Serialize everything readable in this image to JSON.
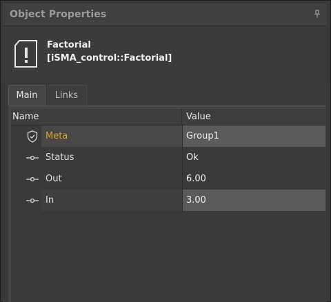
{
  "panel": {
    "title": "Object Properties",
    "pin_icon": "pin-icon"
  },
  "object": {
    "name": "Factorial",
    "type": "[iSMA_control::Factorial]",
    "icon": "warning-box-icon"
  },
  "tabs": [
    {
      "label": "Main",
      "active": true
    },
    {
      "label": "Links",
      "active": false
    }
  ],
  "grid": {
    "columns": {
      "name": "Name",
      "value": "Value"
    },
    "rows": [
      {
        "name": "Meta",
        "value": "Group1",
        "icon": "shield-icon",
        "name_color": "#e0a020"
      },
      {
        "name": "Status",
        "value": "Ok",
        "icon": "slot-connector-icon"
      },
      {
        "name": "Out",
        "value": "6.00",
        "icon": "slot-connector-icon"
      },
      {
        "name": "In",
        "value": "3.00",
        "icon": "slot-connector-icon"
      }
    ]
  }
}
